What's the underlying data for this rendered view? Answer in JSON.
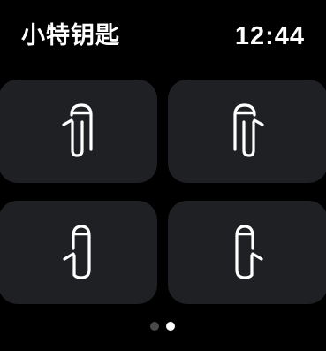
{
  "header": {
    "title": "小特钥匙",
    "time": "12:44"
  },
  "tiles": [
    {
      "icon": "left-front-door-open-icon",
      "door": "left-front"
    },
    {
      "icon": "right-front-door-open-icon",
      "door": "right-front"
    },
    {
      "icon": "left-rear-door-open-icon",
      "door": "left-rear"
    },
    {
      "icon": "right-rear-door-open-icon",
      "door": "right-rear"
    }
  ],
  "pager": {
    "pages": 2,
    "current": 2
  },
  "colors": {
    "background": "#000000",
    "tile": "#1f2023",
    "icon": "#ffffff",
    "pager_inactive": "#4a4a4c",
    "pager_active": "#ffffff"
  }
}
